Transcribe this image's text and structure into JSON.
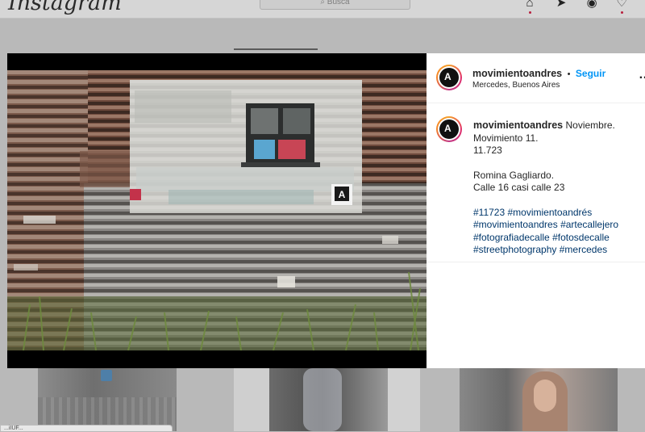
{
  "background": {
    "logo": "Instagram",
    "search_placeholder": "⌕ Busca",
    "status_text": "...iIUF..."
  },
  "post": {
    "username": "movimientoandres",
    "follow_label": "Seguir",
    "separator": "•",
    "location": "Mercedes, Buenos Aires",
    "caption": {
      "author": "movimientoandres",
      "first_word": "Noviembre.",
      "lines": [
        "Movimiento 11.",
        "11.723"
      ],
      "lines2": [
        "Romina Gagliardo.",
        "Calle 16 casi calle 23"
      ],
      "hashtags": [
        [
          "#11723",
          "#movimientoandrés"
        ],
        [
          "#movimientoandres",
          "#artecallejero"
        ],
        [
          "#fotografiadecalle",
          "#fotosdecalle"
        ],
        [
          "#streetphotography",
          "#mercedes"
        ]
      ]
    },
    "more_icon": "…"
  },
  "colors": {
    "accent": "#0095f6",
    "hashtag": "#00376b",
    "ring": "#e1306c"
  }
}
